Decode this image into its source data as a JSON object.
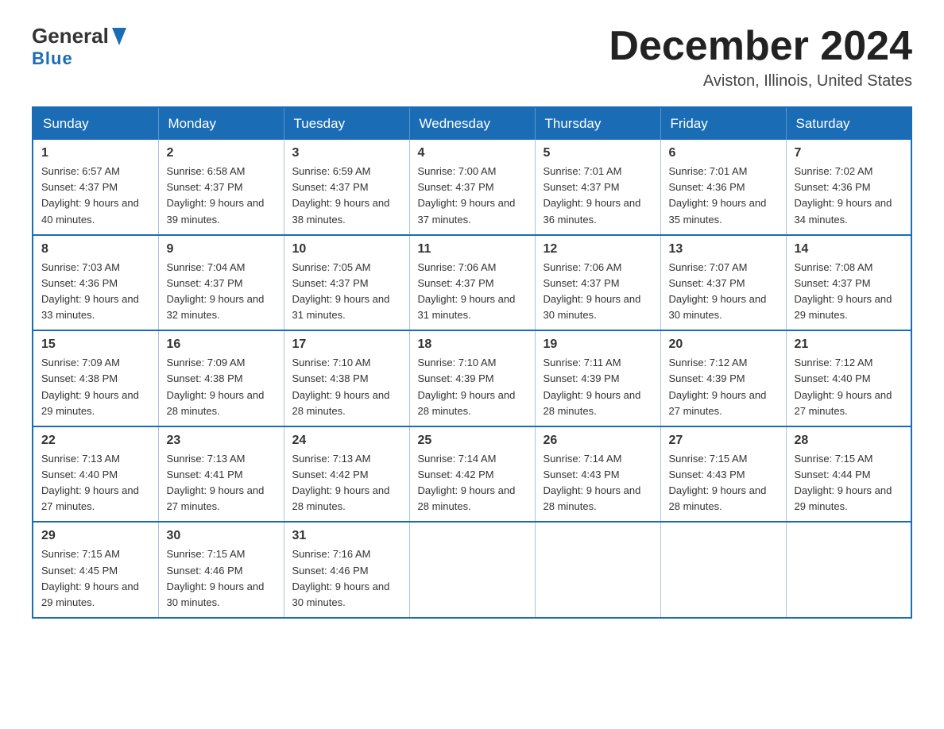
{
  "header": {
    "logo": {
      "line1": "General",
      "line2": "Blue"
    },
    "title": "December 2024",
    "location": "Aviston, Illinois, United States"
  },
  "days_of_week": [
    "Sunday",
    "Monday",
    "Tuesday",
    "Wednesday",
    "Thursday",
    "Friday",
    "Saturday"
  ],
  "weeks": [
    [
      {
        "day": "1",
        "sunrise": "Sunrise: 6:57 AM",
        "sunset": "Sunset: 4:37 PM",
        "daylight": "Daylight: 9 hours and 40 minutes."
      },
      {
        "day": "2",
        "sunrise": "Sunrise: 6:58 AM",
        "sunset": "Sunset: 4:37 PM",
        "daylight": "Daylight: 9 hours and 39 minutes."
      },
      {
        "day": "3",
        "sunrise": "Sunrise: 6:59 AM",
        "sunset": "Sunset: 4:37 PM",
        "daylight": "Daylight: 9 hours and 38 minutes."
      },
      {
        "day": "4",
        "sunrise": "Sunrise: 7:00 AM",
        "sunset": "Sunset: 4:37 PM",
        "daylight": "Daylight: 9 hours and 37 minutes."
      },
      {
        "day": "5",
        "sunrise": "Sunrise: 7:01 AM",
        "sunset": "Sunset: 4:37 PM",
        "daylight": "Daylight: 9 hours and 36 minutes."
      },
      {
        "day": "6",
        "sunrise": "Sunrise: 7:01 AM",
        "sunset": "Sunset: 4:36 PM",
        "daylight": "Daylight: 9 hours and 35 minutes."
      },
      {
        "day": "7",
        "sunrise": "Sunrise: 7:02 AM",
        "sunset": "Sunset: 4:36 PM",
        "daylight": "Daylight: 9 hours and 34 minutes."
      }
    ],
    [
      {
        "day": "8",
        "sunrise": "Sunrise: 7:03 AM",
        "sunset": "Sunset: 4:36 PM",
        "daylight": "Daylight: 9 hours and 33 minutes."
      },
      {
        "day": "9",
        "sunrise": "Sunrise: 7:04 AM",
        "sunset": "Sunset: 4:37 PM",
        "daylight": "Daylight: 9 hours and 32 minutes."
      },
      {
        "day": "10",
        "sunrise": "Sunrise: 7:05 AM",
        "sunset": "Sunset: 4:37 PM",
        "daylight": "Daylight: 9 hours and 31 minutes."
      },
      {
        "day": "11",
        "sunrise": "Sunrise: 7:06 AM",
        "sunset": "Sunset: 4:37 PM",
        "daylight": "Daylight: 9 hours and 31 minutes."
      },
      {
        "day": "12",
        "sunrise": "Sunrise: 7:06 AM",
        "sunset": "Sunset: 4:37 PM",
        "daylight": "Daylight: 9 hours and 30 minutes."
      },
      {
        "day": "13",
        "sunrise": "Sunrise: 7:07 AM",
        "sunset": "Sunset: 4:37 PM",
        "daylight": "Daylight: 9 hours and 30 minutes."
      },
      {
        "day": "14",
        "sunrise": "Sunrise: 7:08 AM",
        "sunset": "Sunset: 4:37 PM",
        "daylight": "Daylight: 9 hours and 29 minutes."
      }
    ],
    [
      {
        "day": "15",
        "sunrise": "Sunrise: 7:09 AM",
        "sunset": "Sunset: 4:38 PM",
        "daylight": "Daylight: 9 hours and 29 minutes."
      },
      {
        "day": "16",
        "sunrise": "Sunrise: 7:09 AM",
        "sunset": "Sunset: 4:38 PM",
        "daylight": "Daylight: 9 hours and 28 minutes."
      },
      {
        "day": "17",
        "sunrise": "Sunrise: 7:10 AM",
        "sunset": "Sunset: 4:38 PM",
        "daylight": "Daylight: 9 hours and 28 minutes."
      },
      {
        "day": "18",
        "sunrise": "Sunrise: 7:10 AM",
        "sunset": "Sunset: 4:39 PM",
        "daylight": "Daylight: 9 hours and 28 minutes."
      },
      {
        "day": "19",
        "sunrise": "Sunrise: 7:11 AM",
        "sunset": "Sunset: 4:39 PM",
        "daylight": "Daylight: 9 hours and 28 minutes."
      },
      {
        "day": "20",
        "sunrise": "Sunrise: 7:12 AM",
        "sunset": "Sunset: 4:39 PM",
        "daylight": "Daylight: 9 hours and 27 minutes."
      },
      {
        "day": "21",
        "sunrise": "Sunrise: 7:12 AM",
        "sunset": "Sunset: 4:40 PM",
        "daylight": "Daylight: 9 hours and 27 minutes."
      }
    ],
    [
      {
        "day": "22",
        "sunrise": "Sunrise: 7:13 AM",
        "sunset": "Sunset: 4:40 PM",
        "daylight": "Daylight: 9 hours and 27 minutes."
      },
      {
        "day": "23",
        "sunrise": "Sunrise: 7:13 AM",
        "sunset": "Sunset: 4:41 PM",
        "daylight": "Daylight: 9 hours and 27 minutes."
      },
      {
        "day": "24",
        "sunrise": "Sunrise: 7:13 AM",
        "sunset": "Sunset: 4:42 PM",
        "daylight": "Daylight: 9 hours and 28 minutes."
      },
      {
        "day": "25",
        "sunrise": "Sunrise: 7:14 AM",
        "sunset": "Sunset: 4:42 PM",
        "daylight": "Daylight: 9 hours and 28 minutes."
      },
      {
        "day": "26",
        "sunrise": "Sunrise: 7:14 AM",
        "sunset": "Sunset: 4:43 PM",
        "daylight": "Daylight: 9 hours and 28 minutes."
      },
      {
        "day": "27",
        "sunrise": "Sunrise: 7:15 AM",
        "sunset": "Sunset: 4:43 PM",
        "daylight": "Daylight: 9 hours and 28 minutes."
      },
      {
        "day": "28",
        "sunrise": "Sunrise: 7:15 AM",
        "sunset": "Sunset: 4:44 PM",
        "daylight": "Daylight: 9 hours and 29 minutes."
      }
    ],
    [
      {
        "day": "29",
        "sunrise": "Sunrise: 7:15 AM",
        "sunset": "Sunset: 4:45 PM",
        "daylight": "Daylight: 9 hours and 29 minutes."
      },
      {
        "day": "30",
        "sunrise": "Sunrise: 7:15 AM",
        "sunset": "Sunset: 4:46 PM",
        "daylight": "Daylight: 9 hours and 30 minutes."
      },
      {
        "day": "31",
        "sunrise": "Sunrise: 7:16 AM",
        "sunset": "Sunset: 4:46 PM",
        "daylight": "Daylight: 9 hours and 30 minutes."
      },
      null,
      null,
      null,
      null
    ]
  ]
}
